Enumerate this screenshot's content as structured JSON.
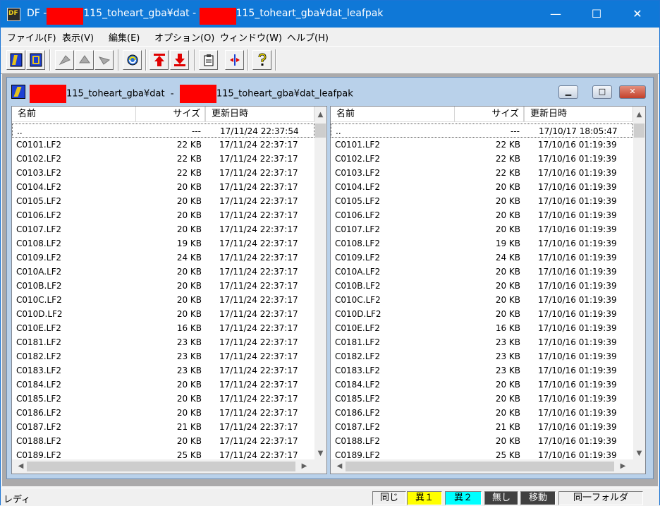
{
  "window": {
    "title_prefix": "DF - ",
    "title_left_path": "115_toheart_gba¥dat",
    "title_sep": " - ",
    "title_right_path": "115_toheart_gba¥dat_leafpak",
    "min_glyph": "—",
    "max_glyph": "☐",
    "close_glyph": "✕"
  },
  "menu": [
    "ファイル(F)",
    "表示(V)",
    "編集(E)",
    "オプション(O)",
    "ウィンドウ(W)",
    "ヘルプ(H)"
  ],
  "toolbar": {
    "icons": [
      "open-folder-icon",
      "open-file-icon",
      "compare-icon",
      "sync-icon",
      "swap-icon",
      "refresh-icon",
      "copy-up-icon",
      "copy-down-icon",
      "clipboard-icon",
      "split-icon",
      "help-icon"
    ]
  },
  "child": {
    "left_path": "115_toheart_gba¥dat",
    "sep": "  -  ",
    "right_path": "115_toheart_gba¥dat_leafpak",
    "min_glyph": "▁",
    "max_glyph": "□",
    "close_glyph": "✕"
  },
  "columns": {
    "name": "名前",
    "size": "サイズ",
    "date": "更新日時"
  },
  "scroll": {
    "up": "▲",
    "down": "▼",
    "left": "◀",
    "right": "▶"
  },
  "left_pane": {
    "rows": [
      {
        "name": "..",
        "size": "---",
        "date": "17/11/24 22:37:54"
      },
      {
        "name": "C0101.LF2",
        "size": "22 KB",
        "date": "17/11/24 22:37:17"
      },
      {
        "name": "C0102.LF2",
        "size": "22 KB",
        "date": "17/11/24 22:37:17"
      },
      {
        "name": "C0103.LF2",
        "size": "22 KB",
        "date": "17/11/24 22:37:17"
      },
      {
        "name": "C0104.LF2",
        "size": "20 KB",
        "date": "17/11/24 22:37:17"
      },
      {
        "name": "C0105.LF2",
        "size": "20 KB",
        "date": "17/11/24 22:37:17"
      },
      {
        "name": "C0106.LF2",
        "size": "20 KB",
        "date": "17/11/24 22:37:17"
      },
      {
        "name": "C0107.LF2",
        "size": "20 KB",
        "date": "17/11/24 22:37:17"
      },
      {
        "name": "C0108.LF2",
        "size": "19 KB",
        "date": "17/11/24 22:37:17"
      },
      {
        "name": "C0109.LF2",
        "size": "24 KB",
        "date": "17/11/24 22:37:17"
      },
      {
        "name": "C010A.LF2",
        "size": "20 KB",
        "date": "17/11/24 22:37:17"
      },
      {
        "name": "C010B.LF2",
        "size": "20 KB",
        "date": "17/11/24 22:37:17"
      },
      {
        "name": "C010C.LF2",
        "size": "20 KB",
        "date": "17/11/24 22:37:17"
      },
      {
        "name": "C010D.LF2",
        "size": "20 KB",
        "date": "17/11/24 22:37:17"
      },
      {
        "name": "C010E.LF2",
        "size": "16 KB",
        "date": "17/11/24 22:37:17"
      },
      {
        "name": "C0181.LF2",
        "size": "23 KB",
        "date": "17/11/24 22:37:17"
      },
      {
        "name": "C0182.LF2",
        "size": "23 KB",
        "date": "17/11/24 22:37:17"
      },
      {
        "name": "C0183.LF2",
        "size": "23 KB",
        "date": "17/11/24 22:37:17"
      },
      {
        "name": "C0184.LF2",
        "size": "20 KB",
        "date": "17/11/24 22:37:17"
      },
      {
        "name": "C0185.LF2",
        "size": "20 KB",
        "date": "17/11/24 22:37:17"
      },
      {
        "name": "C0186.LF2",
        "size": "20 KB",
        "date": "17/11/24 22:37:17"
      },
      {
        "name": "C0187.LF2",
        "size": "21 KB",
        "date": "17/11/24 22:37:17"
      },
      {
        "name": "C0188.LF2",
        "size": "20 KB",
        "date": "17/11/24 22:37:17"
      },
      {
        "name": "C0189.LF2",
        "size": "25 KB",
        "date": "17/11/24 22:37:17"
      }
    ]
  },
  "right_pane": {
    "rows": [
      {
        "name": "..",
        "size": "---",
        "date": "17/10/17 18:05:47"
      },
      {
        "name": "C0101.LF2",
        "size": "22 KB",
        "date": "17/10/16 01:19:39"
      },
      {
        "name": "C0102.LF2",
        "size": "22 KB",
        "date": "17/10/16 01:19:39"
      },
      {
        "name": "C0103.LF2",
        "size": "22 KB",
        "date": "17/10/16 01:19:39"
      },
      {
        "name": "C0104.LF2",
        "size": "20 KB",
        "date": "17/10/16 01:19:39"
      },
      {
        "name": "C0105.LF2",
        "size": "20 KB",
        "date": "17/10/16 01:19:39"
      },
      {
        "name": "C0106.LF2",
        "size": "20 KB",
        "date": "17/10/16 01:19:39"
      },
      {
        "name": "C0107.LF2",
        "size": "20 KB",
        "date": "17/10/16 01:19:39"
      },
      {
        "name": "C0108.LF2",
        "size": "19 KB",
        "date": "17/10/16 01:19:39"
      },
      {
        "name": "C0109.LF2",
        "size": "24 KB",
        "date": "17/10/16 01:19:39"
      },
      {
        "name": "C010A.LF2",
        "size": "20 KB",
        "date": "17/10/16 01:19:39"
      },
      {
        "name": "C010B.LF2",
        "size": "20 KB",
        "date": "17/10/16 01:19:39"
      },
      {
        "name": "C010C.LF2",
        "size": "20 KB",
        "date": "17/10/16 01:19:39"
      },
      {
        "name": "C010D.LF2",
        "size": "20 KB",
        "date": "17/10/16 01:19:39"
      },
      {
        "name": "C010E.LF2",
        "size": "16 KB",
        "date": "17/10/16 01:19:39"
      },
      {
        "name": "C0181.LF2",
        "size": "23 KB",
        "date": "17/10/16 01:19:39"
      },
      {
        "name": "C0182.LF2",
        "size": "23 KB",
        "date": "17/10/16 01:19:39"
      },
      {
        "name": "C0183.LF2",
        "size": "23 KB",
        "date": "17/10/16 01:19:39"
      },
      {
        "name": "C0184.LF2",
        "size": "20 KB",
        "date": "17/10/16 01:19:39"
      },
      {
        "name": "C0185.LF2",
        "size": "20 KB",
        "date": "17/10/16 01:19:39"
      },
      {
        "name": "C0186.LF2",
        "size": "20 KB",
        "date": "17/10/16 01:19:39"
      },
      {
        "name": "C0187.LF2",
        "size": "21 KB",
        "date": "17/10/16 01:19:39"
      },
      {
        "name": "C0188.LF2",
        "size": "20 KB",
        "date": "17/10/16 01:19:39"
      },
      {
        "name": "C0189.LF2",
        "size": "25 KB",
        "date": "17/10/16 01:19:39"
      }
    ]
  },
  "status": {
    "text": "レディ",
    "indicators": [
      {
        "label": "同じ",
        "bg": "#f0f0f0",
        "fg": "#000000"
      },
      {
        "label": "異１",
        "bg": "#ffff00",
        "fg": "#000000"
      },
      {
        "label": "異２",
        "bg": "#00ffff",
        "fg": "#000000"
      },
      {
        "label": "無し",
        "bg": "#404040",
        "fg": "#ffffff"
      },
      {
        "label": "移動",
        "bg": "#404040",
        "fg": "#ffffff"
      },
      {
        "label": "同一フォルダ",
        "bg": "#f0f0f0",
        "fg": "#000000"
      }
    ]
  },
  "colors": {
    "titlebar": "#0f78d7",
    "redaction": "#ff0000",
    "mdi_bg": "#abaaab",
    "child_frame": "#b9d1ea"
  }
}
